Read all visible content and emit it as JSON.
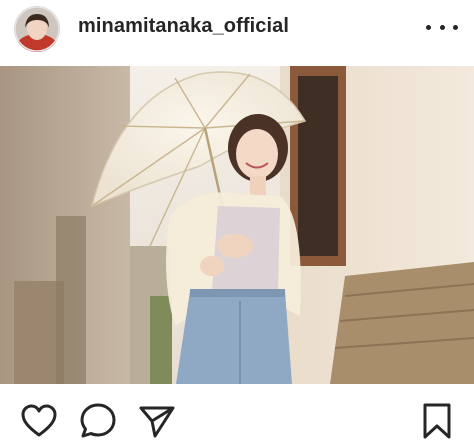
{
  "post": {
    "username": "minamitanaka_official"
  },
  "icons": {
    "more": "more-options-icon",
    "like": "heart-icon",
    "comment": "comment-bubble-icon",
    "share": "paper-plane-icon",
    "save": "bookmark-icon"
  },
  "colors": {
    "text": "#262626",
    "background": "#ffffff"
  }
}
